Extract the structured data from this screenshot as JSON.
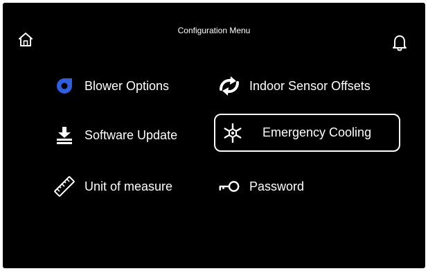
{
  "header": {
    "title": "Configuration Menu",
    "home_icon": "home-icon",
    "bell_icon": "bell-icon"
  },
  "menu": {
    "items": [
      {
        "label": "Blower Options",
        "icon": "blower-icon",
        "icon_color": "#2f5fe0"
      },
      {
        "label": "Indoor Sensor Offsets",
        "icon": "sync-arrows-icon"
      },
      {
        "label": "Software Update",
        "icon": "download-icon"
      },
      {
        "label": "Emergency Cooling",
        "icon": "snowflake-icon",
        "selected": true
      },
      {
        "label": "Unit of measure",
        "icon": "ruler-icon"
      },
      {
        "label": "Password",
        "icon": "key-icon"
      }
    ]
  },
  "colors": {
    "background": "#000000",
    "text": "#ffffff",
    "accent": "#2f5fe0"
  }
}
